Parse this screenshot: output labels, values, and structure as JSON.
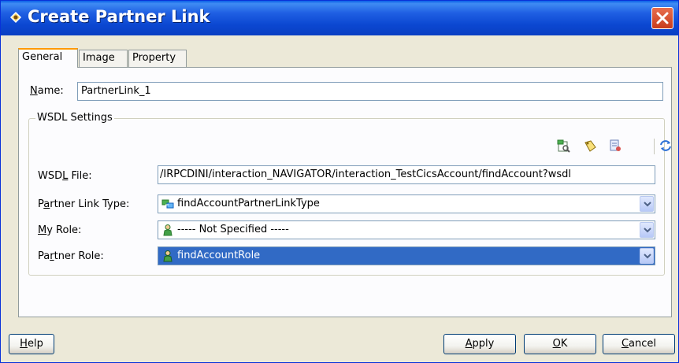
{
  "window": {
    "title": "Create Partner Link"
  },
  "tabs": [
    {
      "label": "General"
    },
    {
      "label": "Image"
    },
    {
      "label": "Property"
    }
  ],
  "general": {
    "name_label_mnemonic": "N",
    "name_label_rest": "ame:",
    "name_value": "PartnerLink_1"
  },
  "wsdl": {
    "group_title": "WSDL Settings",
    "file_label_pre": "WSD",
    "file_label_mnemonic": "L",
    "file_label_post": " File:",
    "file_value": "/IRPCDINI/interaction_NAVIGATOR/interaction_TestCicsAccount/findAccount?wsdl",
    "plt_label_pre": "P",
    "plt_label_mnemonic": "a",
    "plt_label_post": "rtner Link Type:",
    "plt_value": "findAccountPartnerLinkType",
    "my_role_label_mnemonic": "M",
    "my_role_label_rest": "y Role:",
    "my_role_value": "----- Not Specified -----",
    "partner_role_label_pre": "Pa",
    "partner_role_label_mnemonic": "r",
    "partner_role_label_post": "tner Role:",
    "partner_role_value": "findAccountRole",
    "toolbar_icons": [
      "browse-wsdl-icon",
      "create-wsdl-icon",
      "service-explorer-icon",
      "refresh-icon"
    ]
  },
  "buttons": {
    "help_mnemonic": "H",
    "help_rest": "elp",
    "apply_mnemonic": "A",
    "apply_rest": "pply",
    "ok_mnemonic": "O",
    "ok_rest": "K",
    "cancel_mnemonic": "C",
    "cancel_rest": "ancel"
  },
  "colors": {
    "titlebar": "#0b47d1",
    "close_button": "#c83c1c",
    "selection": "#316ac5",
    "tab_accent": "#ff9900",
    "dialog_bg": "#ece9d8"
  }
}
